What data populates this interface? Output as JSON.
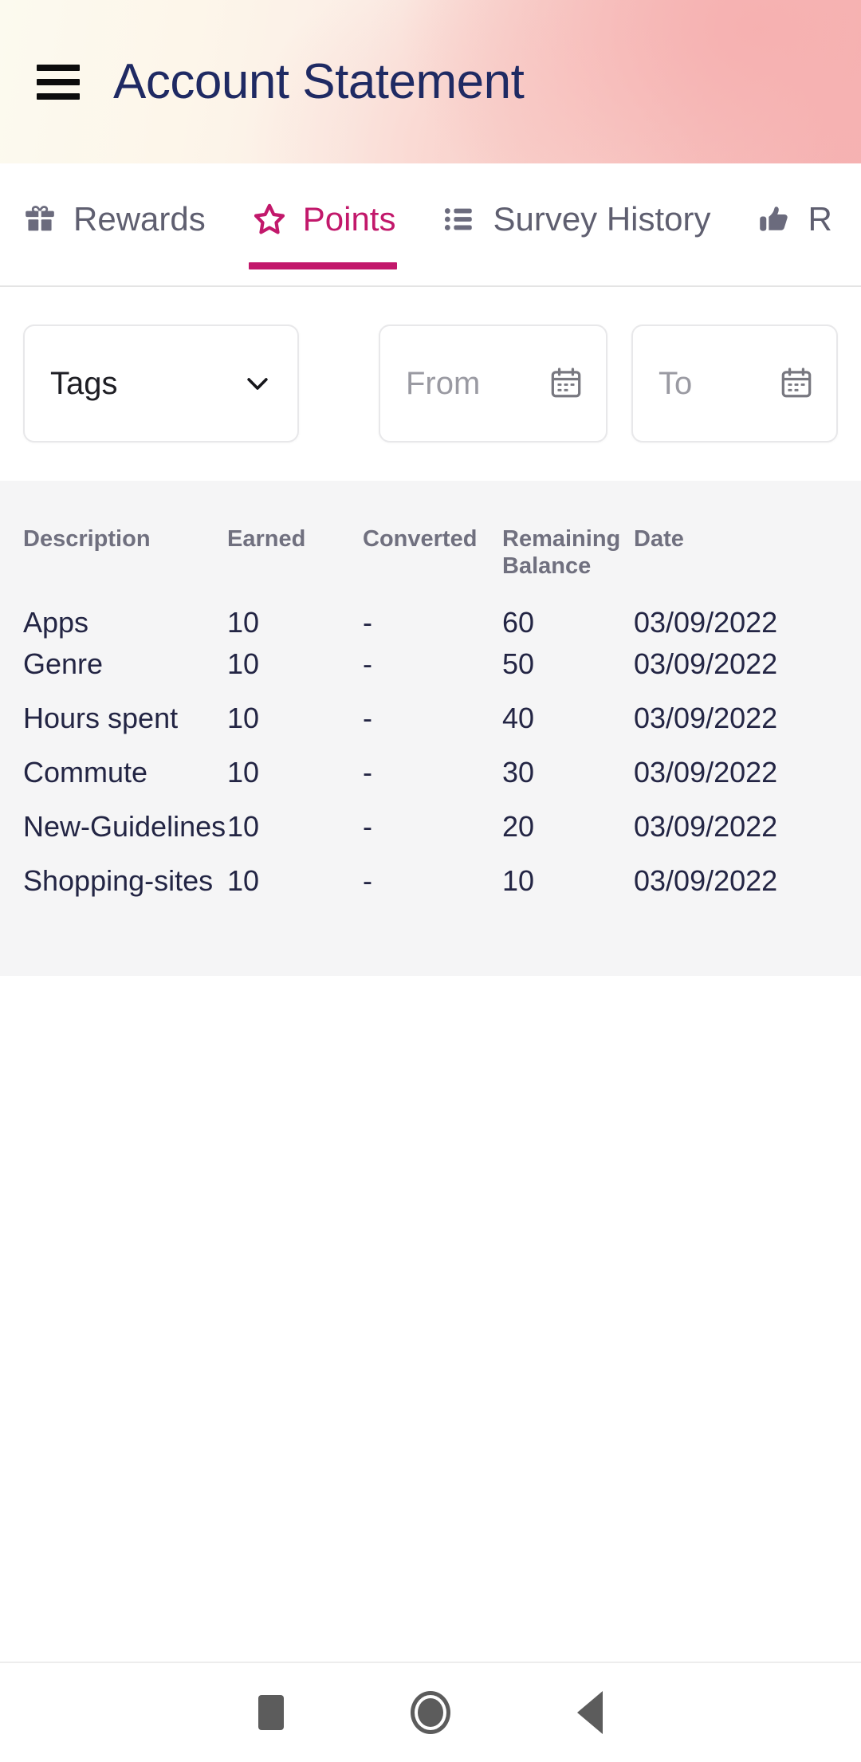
{
  "header": {
    "title": "Account Statement",
    "menu_icon": "hamburger-menu-icon",
    "gradient_left": "#fcfaef",
    "gradient_right": "#f5b3b3",
    "title_color": "#1f2a63"
  },
  "tabs": {
    "accent_color": "#c2186b",
    "inactive_color": "#5f5f70",
    "items": [
      {
        "label": "Rewards",
        "icon": "gift-icon",
        "active": false
      },
      {
        "label": "Points",
        "icon": "star-icon",
        "active": true
      },
      {
        "label": "Survey History",
        "icon": "list-icon",
        "active": false
      },
      {
        "label": "R",
        "icon": "thumbs-up-icon",
        "active": false
      }
    ]
  },
  "filters": {
    "tags": {
      "label": "Tags",
      "icon": "chevron-down-icon"
    },
    "from": {
      "placeholder": "From",
      "value": "",
      "icon": "calendar-icon"
    },
    "to": {
      "placeholder": "To",
      "value": "",
      "icon": "calendar-icon"
    }
  },
  "table": {
    "columns": [
      "Description",
      "Earned",
      "Converted",
      "Remaining Balance",
      "Date"
    ],
    "rows": [
      {
        "description": "Apps",
        "earned": "10",
        "converted": "-",
        "remaining": "60",
        "date": "03/09/2022"
      },
      {
        "description": "Genre",
        "earned": "10",
        "converted": "-",
        "remaining": "50",
        "date": "03/09/2022"
      },
      {
        "description": "Hours spent",
        "earned": "10",
        "converted": "-",
        "remaining": "40",
        "date": "03/09/2022"
      },
      {
        "description": "Commute",
        "earned": "10",
        "converted": "-",
        "remaining": "30",
        "date": "03/09/2022"
      },
      {
        "description": "New-Guidelines",
        "earned": "10",
        "converted": "-",
        "remaining": "20",
        "date": "03/09/2022"
      },
      {
        "description": "Shopping-sites",
        "earned": "10",
        "converted": "-",
        "remaining": "10",
        "date": "03/09/2022"
      }
    ]
  },
  "navbar": {
    "recents": "recents-square-icon",
    "home": "home-circle-icon",
    "back": "back-triangle-icon"
  }
}
